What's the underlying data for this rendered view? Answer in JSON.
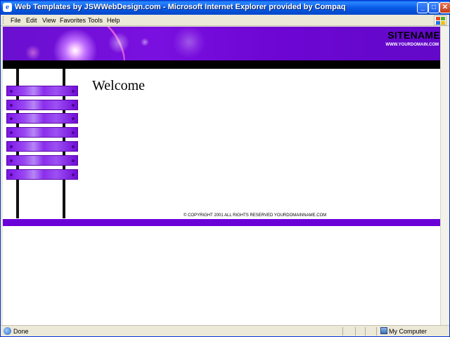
{
  "window": {
    "title": "Web Templates by JSWWebDesign.com - Microsoft Internet Explorer provided by Compaq",
    "minimize_label": "_",
    "maximize_label": "□",
    "close_label": "✕"
  },
  "menu": {
    "items": [
      {
        "label": "File"
      },
      {
        "label": "Edit"
      },
      {
        "label": "View"
      },
      {
        "label": "Favorites"
      },
      {
        "label": "Tools"
      },
      {
        "label": "Help"
      }
    ]
  },
  "page": {
    "site_name": "SITENAME",
    "site_url": "WWW.YOURDOMAIN.COM",
    "heading": "Welcome",
    "copyright": "© COPYRIGHT 2001 ALL RIGHTS RESERVED YOURDOMAINNAME.COM",
    "nav_button_count_note": ""
  },
  "status": {
    "text": "Done",
    "zone": "My Computer"
  },
  "colors": {
    "banner_purple": "#7a10e0",
    "footer_purple": "#6a00d8",
    "titlebar_blue": "#0a5ae6"
  }
}
